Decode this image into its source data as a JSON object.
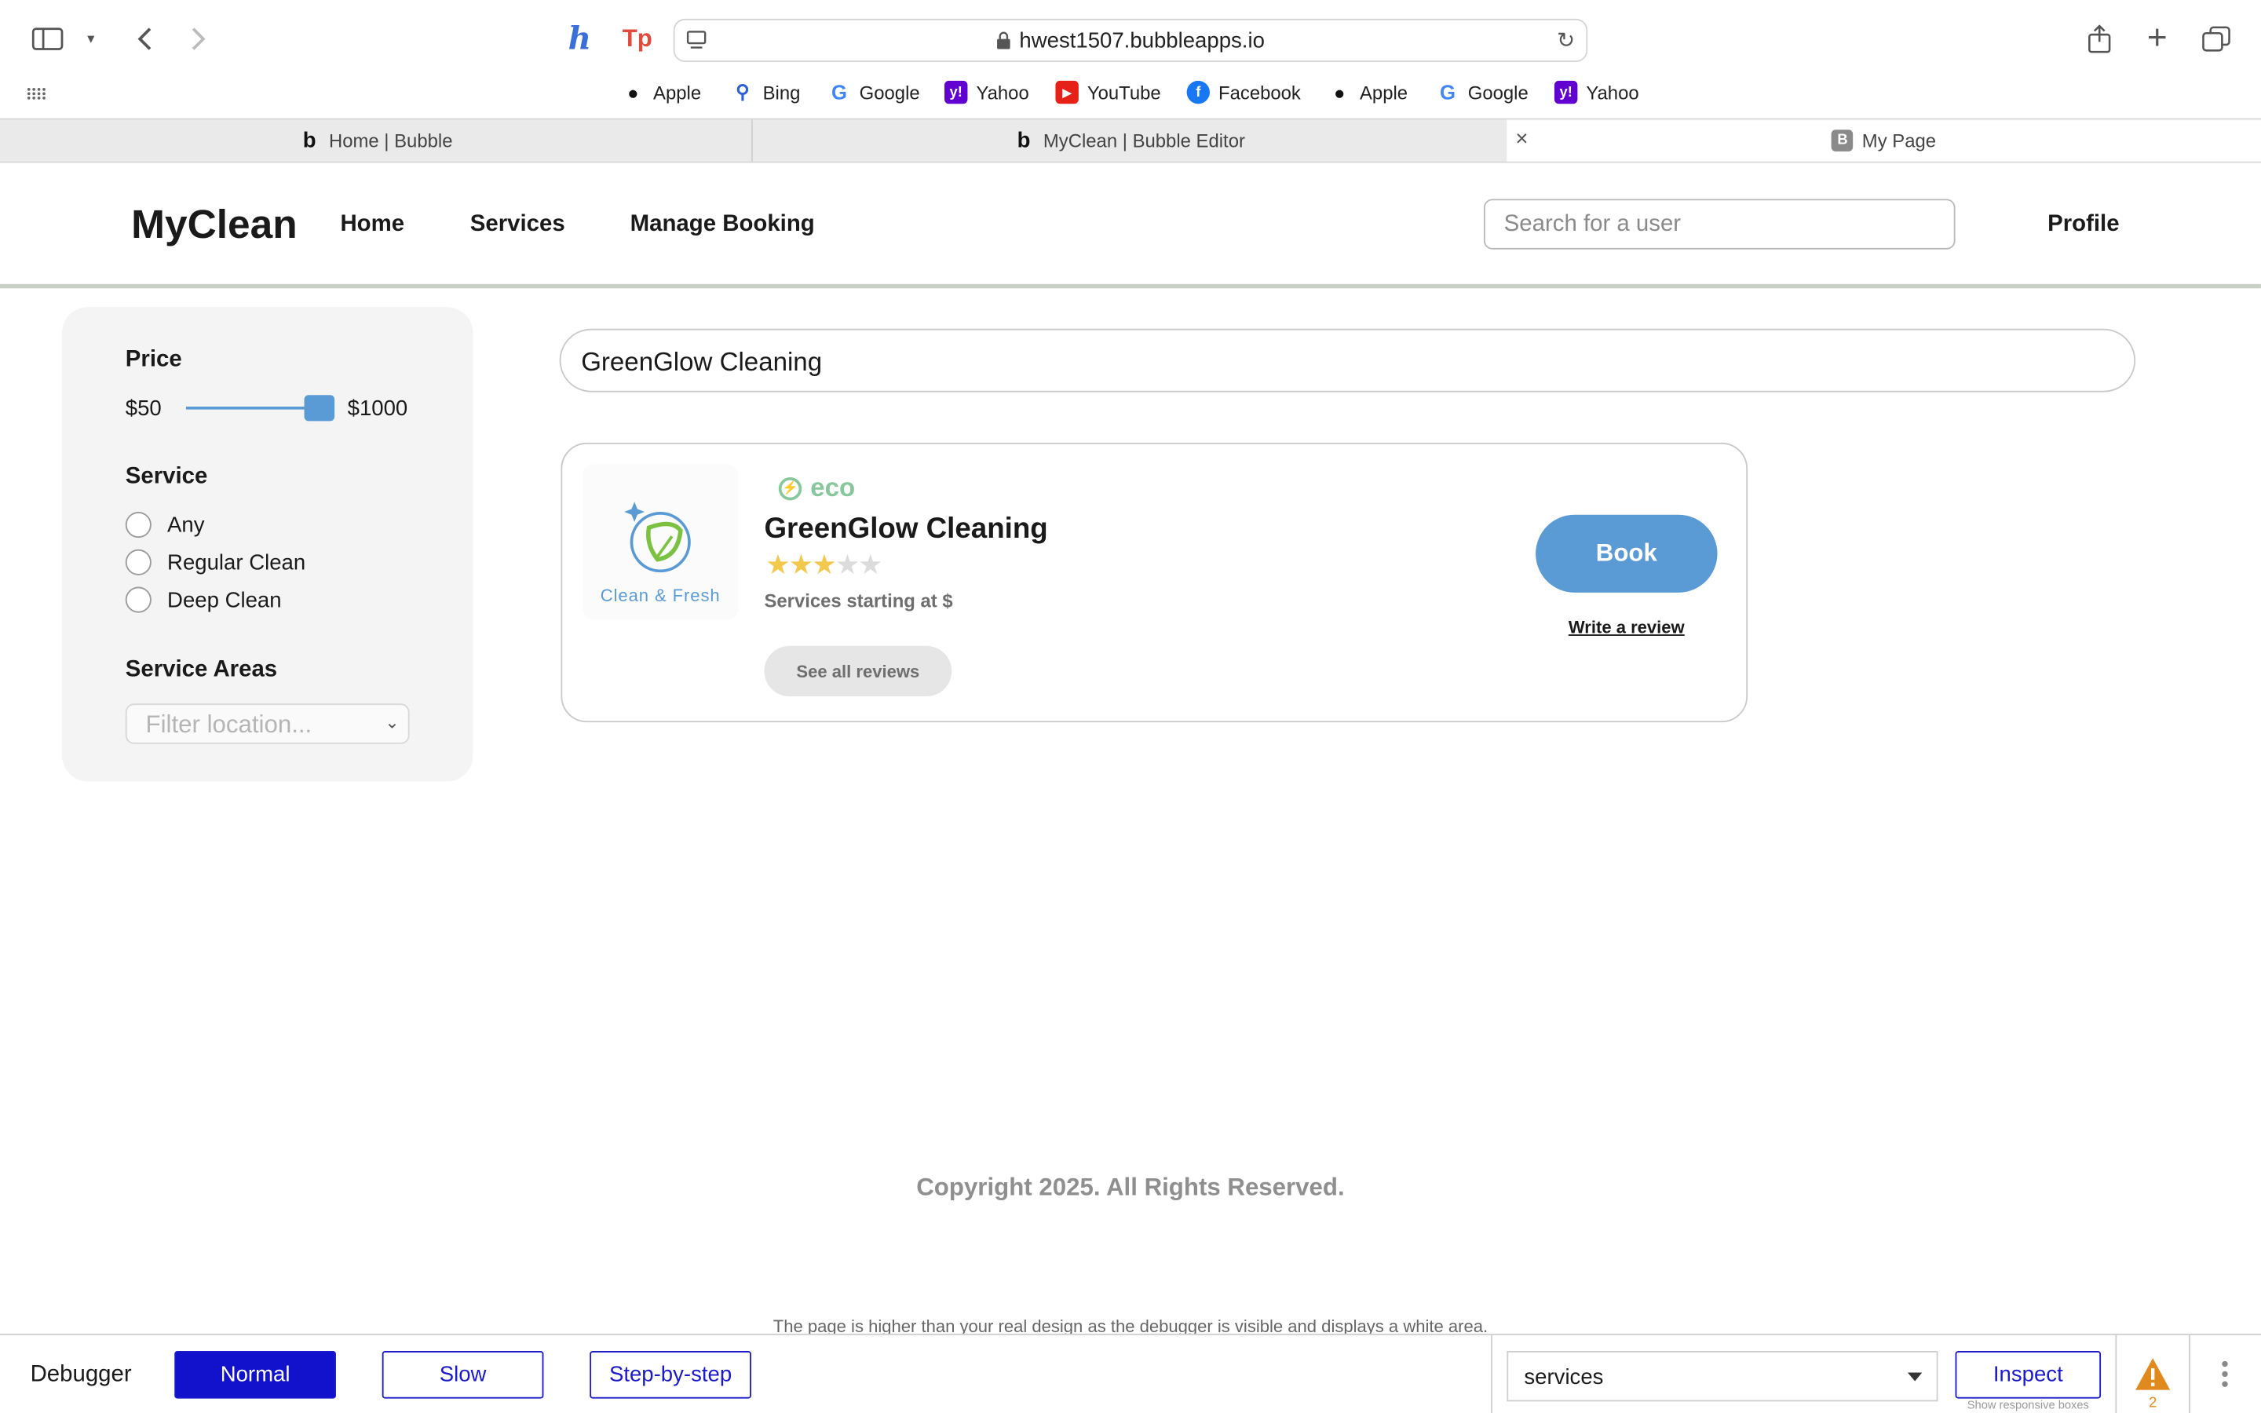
{
  "browser": {
    "url": "hwest1507.bubbleapps.io",
    "favorites": [
      {
        "label": "Apple",
        "icon": "apple-icon"
      },
      {
        "label": "Bing",
        "icon": "bing-search-icon"
      },
      {
        "label": "Google",
        "icon": "google-icon"
      },
      {
        "label": "Yahoo",
        "icon": "yahoo-icon"
      },
      {
        "label": "YouTube",
        "icon": "youtube-icon"
      },
      {
        "label": "Facebook",
        "icon": "facebook-icon"
      },
      {
        "label": "Apple",
        "icon": "apple-icon"
      },
      {
        "label": "Google",
        "icon": "google-icon"
      },
      {
        "label": "Yahoo",
        "icon": "yahoo-icon"
      }
    ],
    "tabs": [
      {
        "label": "Home | Bubble",
        "icon": "bubble-icon",
        "active": false
      },
      {
        "label": "MyClean | Bubble Editor",
        "icon": "bubble-icon",
        "active": false
      },
      {
        "label": "My Page",
        "icon": "b-badge-icon",
        "active": true
      }
    ],
    "tab_badge_letter": "B"
  },
  "header": {
    "logo": "MyClean",
    "nav": [
      "Home",
      "Services",
      "Manage Booking"
    ],
    "search_placeholder": "Search for a user",
    "profile": "Profile"
  },
  "filters": {
    "price_title": "Price",
    "price_min": "$50",
    "price_max": "$1000",
    "price_slider_level": 1.0,
    "service_title": "Service",
    "service_options": [
      "Any",
      "Regular Clean",
      "Deep Clean"
    ],
    "areas_title": "Service Areas",
    "location_placeholder": "Filter location..."
  },
  "search": {
    "value": "GreenGlow Cleaning"
  },
  "result": {
    "logo_text": "Clean & Fresh",
    "eco_label": "eco",
    "name": "GreenGlow Cleaning",
    "rating": 3,
    "rating_max": 5,
    "starting_text": "Services starting at $",
    "all_reviews_label": "See all reviews",
    "book_label": "Book",
    "write_review_label": "Write a review"
  },
  "footer": {
    "copyright": "Copyright 2025. All Rights Reserved.",
    "debug_note": "The page is higher than your real design as the debugger is visible and displays a white area."
  },
  "debugger": {
    "label": "Debugger",
    "modes": [
      "Normal",
      "Slow",
      "Step-by-step"
    ],
    "active_mode": "Normal",
    "element_select": "services",
    "inspect_label": "Inspect",
    "responsive_label": "Show responsive boxes",
    "warning_count": "2"
  },
  "colors": {
    "accent": "#5b9bd5",
    "eco": "#86c79b",
    "star": "#f2c94c",
    "debugger_blue": "#1212cc",
    "warning": "#e08a1e"
  }
}
